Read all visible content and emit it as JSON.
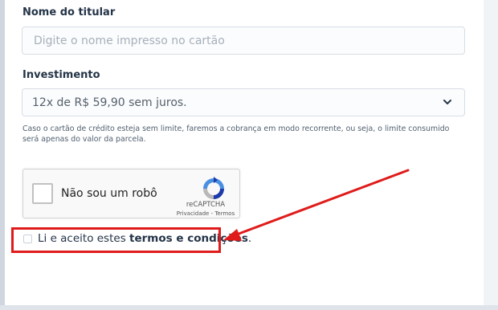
{
  "form": {
    "holder_label": "Nome do titular",
    "holder_placeholder": "Digite o nome impresso no cartão",
    "investment_label": "Investimento",
    "investment_selected": "12x de R$ 59,90 sem juros.",
    "investment_note": "Caso o cartão de crédito esteja sem limite, faremos a cobrança em modo recorrente, ou seja, o limite consumido será apenas do valor da parcela."
  },
  "captcha": {
    "label": "Não sou um robô",
    "brand": "reCAPTCHA",
    "links": "Privacidade - Termos",
    "icon": "recaptcha-logo"
  },
  "terms": {
    "prefix": "Li e aceito estes ",
    "link": "termos e condições",
    "suffix": "."
  },
  "colors": {
    "highlight": "#e01b1b",
    "text": "#243447"
  }
}
